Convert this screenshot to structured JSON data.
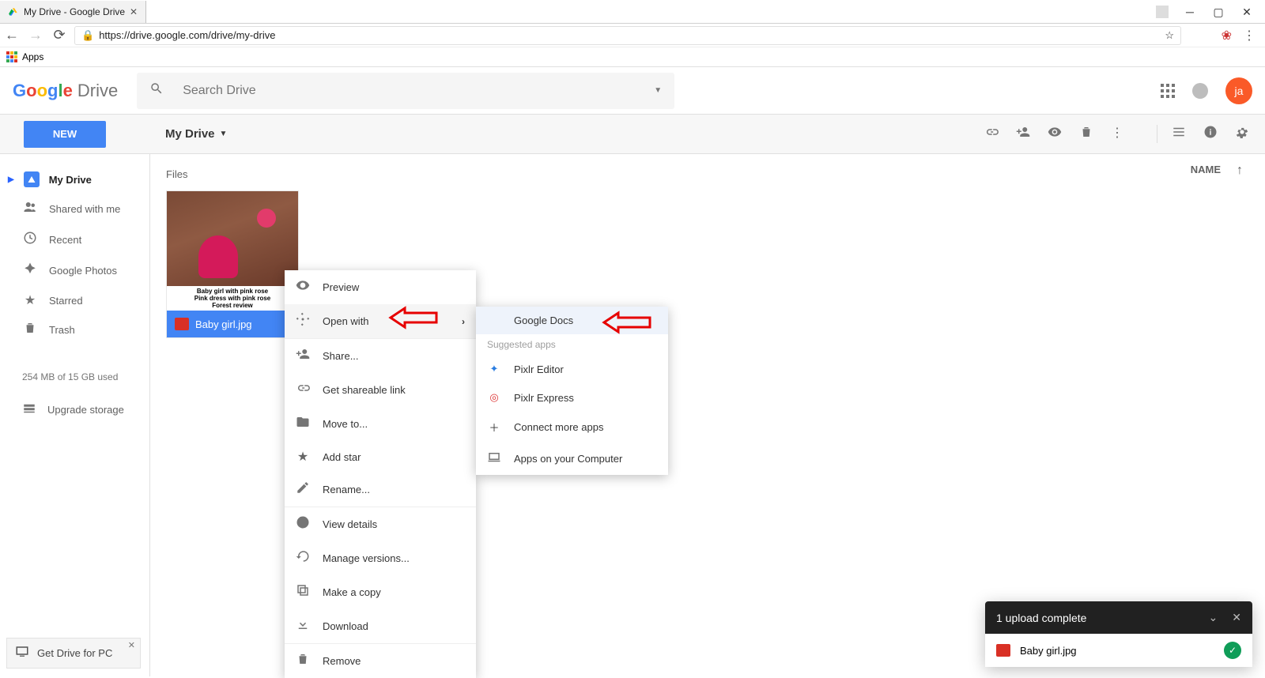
{
  "chrome": {
    "tab_title": "My Drive - Google Drive",
    "url": "https://drive.google.com/drive/my-drive",
    "apps_label": "Apps"
  },
  "header": {
    "logo_product": "Drive",
    "search_placeholder": "Search Drive",
    "avatar_initials": "ja"
  },
  "toolbar": {
    "new_button": "NEW",
    "breadcrumb": "My Drive"
  },
  "sidebar": {
    "my_drive": "My Drive",
    "shared": "Shared with me",
    "recent": "Recent",
    "photos": "Google Photos",
    "starred": "Starred",
    "trash": "Trash",
    "storage_text": "254 MB of 15 GB used",
    "upgrade": "Upgrade storage",
    "get_drive": "Get Drive for PC"
  },
  "content": {
    "files_heading": "Files",
    "sort_label": "NAME",
    "file": {
      "name": "Baby girl.jpg",
      "caption1": "Baby girl with pink rose",
      "caption2": "Pink dress with pink rose",
      "caption3": "Forest review"
    }
  },
  "context_menu": {
    "preview": "Preview",
    "open_with": "Open with",
    "share": "Share...",
    "link": "Get shareable link",
    "move": "Move to...",
    "star": "Add star",
    "rename": "Rename...",
    "details": "View details",
    "versions": "Manage versions...",
    "copy": "Make a copy",
    "download": "Download",
    "remove": "Remove"
  },
  "submenu": {
    "google_docs": "Google Docs",
    "suggested": "Suggested apps",
    "pixlr_editor": "Pixlr Editor",
    "pixlr_express": "Pixlr Express",
    "connect": "Connect more apps",
    "computer": "Apps on your Computer"
  },
  "toast": {
    "title": "1 upload complete",
    "file": "Baby girl.jpg"
  }
}
